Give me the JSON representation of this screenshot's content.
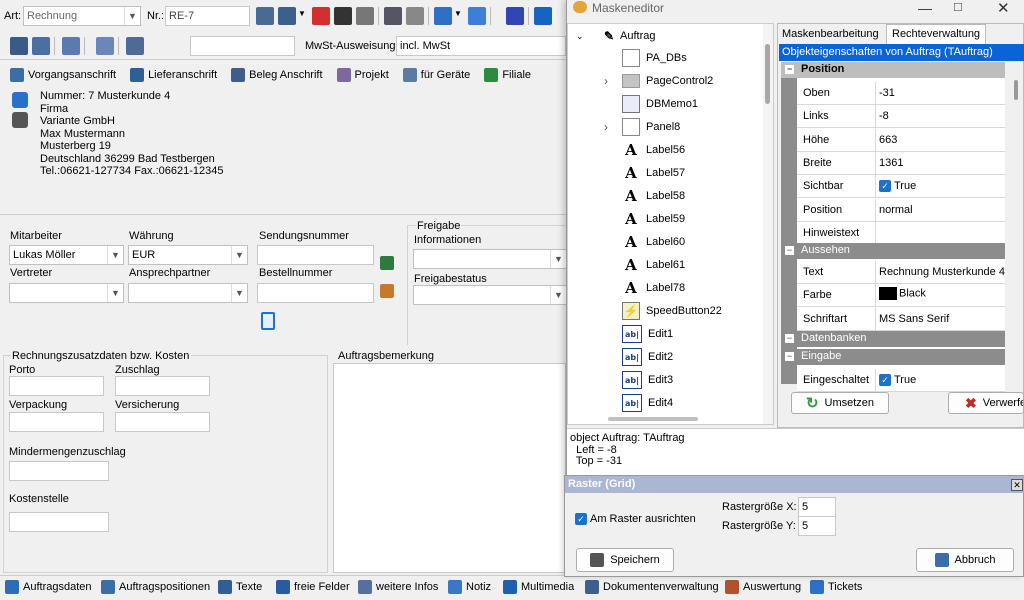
{
  "top": {
    "art_label": "Art:",
    "art_value": "Rechnung",
    "nr_label": "Nr.:",
    "nr_value": "RE-7"
  },
  "row2": {
    "mwst_label": "MwSt-Ausweisung:",
    "mwst_value": "incl. MwSt"
  },
  "addr_tabs": [
    "Vorgangsanschrift",
    "Lieferanschrift",
    "Beleg Anschrift",
    "Projekt",
    "für Geräte",
    "Filiale"
  ],
  "address_lines": [
    "Nummer: 7  Musterkunde 4",
    "Firma",
    "Variante GmbH",
    "Max Mustermann",
    "Musterberg 19",
    "Deutschland 36299 Bad Testbergen",
    "Tel.:06621-127734  Fax.:06621-12345"
  ],
  "fields": {
    "mitarbeiter_label": "Mitarbeiter",
    "mitarbeiter_value": "Lukas Möller",
    "waehrung_label": "Währung",
    "waehrung_value": "EUR",
    "sendung_label": "Sendungsnummer",
    "vertreter_label": "Vertreter",
    "ansprech_label": "Ansprechpartner",
    "bestell_label": "Bestellnummer",
    "freigabe_label": "Freigabe",
    "freigabe_info_label": "Informationen",
    "freigabe_status_label": "Freigabestatus"
  },
  "costs": {
    "group_label": "Rechnungszusatzdaten bzw. Kosten",
    "porto": "Porto",
    "zuschlag": "Zuschlag",
    "verpackung": "Verpackung",
    "versicherung": "Versicherung",
    "minder": "Mindermengenzuschlag",
    "kostenstelle": "Kostenstelle"
  },
  "bemerkung_label": "Auftragsbemerkung",
  "bottom_tabs": [
    "Auftragsdaten",
    "Auftragspositionen",
    "Texte",
    "freie Felder",
    "weitere Infos",
    "Notiz",
    "Multimedia",
    "Dokumentenverwaltung",
    "Auswertung",
    "Tickets"
  ],
  "editor": {
    "title": "Maskeneditor",
    "tree": [
      {
        "label": "Auftrag",
        "icon": "pencil"
      },
      {
        "label": "PA_DBs",
        "icon": "panel"
      },
      {
        "label": "PageControl2",
        "icon": "folder"
      },
      {
        "label": "DBMemo1",
        "icon": "memo"
      },
      {
        "label": "Panel8",
        "icon": "panel"
      },
      {
        "label": "Label56",
        "icon": "A"
      },
      {
        "label": "Label57",
        "icon": "A"
      },
      {
        "label": "Label58",
        "icon": "A"
      },
      {
        "label": "Label59",
        "icon": "A"
      },
      {
        "label": "Label60",
        "icon": "A"
      },
      {
        "label": "Label61",
        "icon": "A"
      },
      {
        "label": "Label78",
        "icon": "A"
      },
      {
        "label": "SpeedButton22",
        "icon": "speed"
      },
      {
        "label": "Edit1",
        "icon": "edit"
      },
      {
        "label": "Edit2",
        "icon": "edit"
      },
      {
        "label": "Edit3",
        "icon": "edit"
      },
      {
        "label": "Edit4",
        "icon": "edit"
      }
    ],
    "tabs": [
      "Maskenbearbeitung",
      "Rechteverwaltung"
    ],
    "obj_header": "Objekteigenschaften von Auftrag (TAuftrag)",
    "cat_position": "Position",
    "cat_aussehen": "Aussehen",
    "cat_datenbanken": "Datenbanken",
    "cat_eingabe": "Eingabe",
    "props_position": [
      {
        "name": "Oben",
        "value": "-31"
      },
      {
        "name": "Links",
        "value": "-8"
      },
      {
        "name": "Höhe",
        "value": "663"
      },
      {
        "name": "Breite",
        "value": "1361"
      },
      {
        "name": "Sichtbar",
        "value": "True"
      },
      {
        "name": "Position",
        "value": "normal"
      },
      {
        "name": "Hinweistext",
        "value": ""
      }
    ],
    "props_aussehen": [
      {
        "name": "Text",
        "value": "Rechnung Musterkunde 4"
      },
      {
        "name": "Farbe",
        "value": "Black"
      },
      {
        "name": "Schriftart",
        "value": "MS Sans Serif"
      }
    ],
    "props_eingabe": [
      {
        "name": "Eingeschaltet",
        "value": "True"
      }
    ],
    "btn_umsetzen": "Umsetzen",
    "btn_verwerfen": "Verwerfen",
    "code_lines": [
      "object Auftrag: TAuftrag",
      "  Left = -8",
      "  Top = -31"
    ]
  },
  "grid": {
    "title": "Raster (Grid)",
    "snap_label": "Am Raster ausrichten",
    "x_label": "Rastergröße X:",
    "x_value": "5",
    "y_label": "Rastergröße Y:",
    "y_value": "5",
    "save": "Speichern",
    "cancel": "Abbruch"
  },
  "colors": {
    "accent": "#1a73c8",
    "header_blue": "#0a64d8",
    "grid_title": "#aab6d2"
  }
}
